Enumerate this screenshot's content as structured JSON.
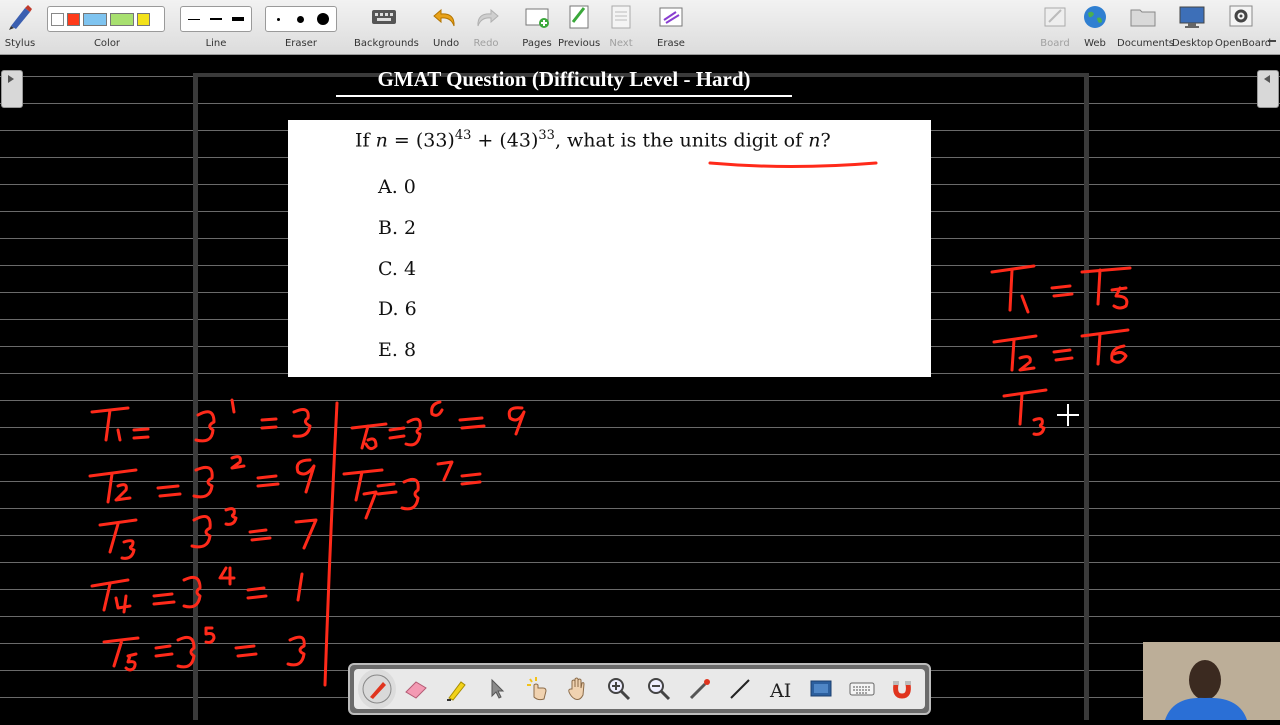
{
  "toolbar": {
    "stylus_label": "Stylus",
    "color_label": "Color",
    "line_label": "Line",
    "eraser_label": "Eraser",
    "backgrounds_label": "Backgrounds",
    "undo_label": "Undo",
    "redo_label": "Redo",
    "pages_label": "Pages",
    "previous_label": "Previous",
    "next_label": "Next",
    "erase_label": "Erase",
    "board_label": "Board",
    "web_label": "Web",
    "documents_label": "Documents",
    "desktop_label": "Desktop",
    "openboard_label": "OpenBoard",
    "colors": [
      "#ffffff",
      "#ff3b1a",
      "#7fc4f0",
      "#a8e070",
      "#f3e21a"
    ]
  },
  "board": {
    "title": "GMAT Question (Difficulty Level - Hard)",
    "question": {
      "prefix": "If ",
      "var_n": "n",
      "eq": " = (33)",
      "exp1": "43",
      "plus": " + (43)",
      "exp2": "33",
      "suffix": ", what is the units digit of ",
      "var_n2": "n",
      "qmark": "?"
    },
    "choices": [
      "A. 0",
      "B. 2",
      "C. 4",
      "D. 6",
      "E. 8"
    ]
  },
  "annotations": {
    "left_column": [
      "T1 = 3¹ = 3",
      "T2 = 3² = 9",
      "T3 3³ = 7",
      "T4 = 3⁴ = 1",
      "T5 = 3⁵ = 3"
    ],
    "middle_column": [
      "T6 = 3⁶ = 9",
      "T7 = 3⁷ ="
    ],
    "right_column": [
      "T1 = T5",
      "T2 = T6",
      "T3"
    ],
    "ink_color": "#ff2a1a"
  }
}
